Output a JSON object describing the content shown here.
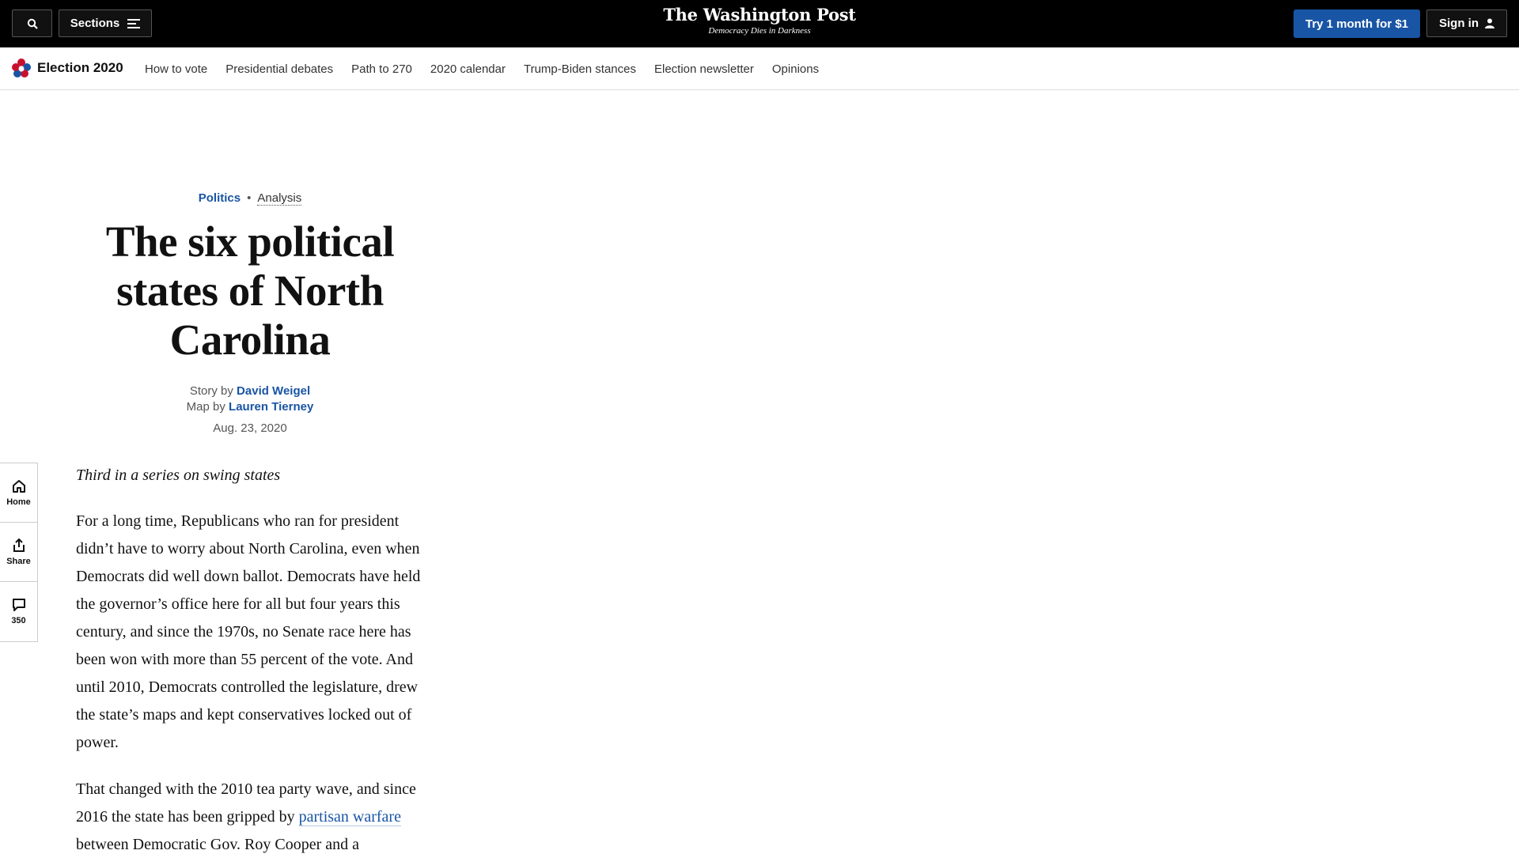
{
  "topbar": {
    "sections_label": "Sections",
    "masthead": "The Washington Post",
    "tagline": "Democracy Dies in Darkness",
    "subscribe_label": "Try 1 month for $1",
    "signin_label": "Sign in"
  },
  "subnav": {
    "brand": "Election 2020",
    "links": [
      "How to vote",
      "Presidential debates",
      "Path to 270",
      "2020 calendar",
      "Trump-Biden stances",
      "Election newsletter",
      "Opinions"
    ]
  },
  "article": {
    "section": "Politics",
    "label": "Analysis",
    "headline": "The six political states of North Carolina",
    "story_prefix": "Story by",
    "story_author": "David Weigel",
    "map_prefix": "Map by",
    "map_author": "Lauren Tierney",
    "date": "Aug. 23, 2020",
    "series_note": "Third in a series on swing states",
    "paragraph1": "For a long time, Republicans who ran for president didn’t have to worry about North Carolina, even when Democrats did well down ballot. Democrats have held the governor’s office here for all but four years this century, and since the 1970s, no Senate race here has been won with more than 55 percent of the vote. And until 2010, Democrats controlled the legislature, drew the state’s maps and kept conservatives locked out of power.",
    "paragraph2_before": "That changed with the 2010 tea party wave, and since 2016 the state has been gripped by ",
    "paragraph2_link": "partisan warfare",
    "paragraph2_after": " between Democratic Gov. Roy Cooper and a"
  },
  "rail": {
    "home_label": "Home",
    "share_label": "Share",
    "comments_count": "350"
  },
  "colors": {
    "accent_blue": "#1955a5",
    "topbar_bg": "#000000"
  },
  "icons": [
    "search-icon",
    "menu-icon",
    "user-icon",
    "election-star-icon",
    "home-icon",
    "share-icon",
    "comment-icon"
  ]
}
